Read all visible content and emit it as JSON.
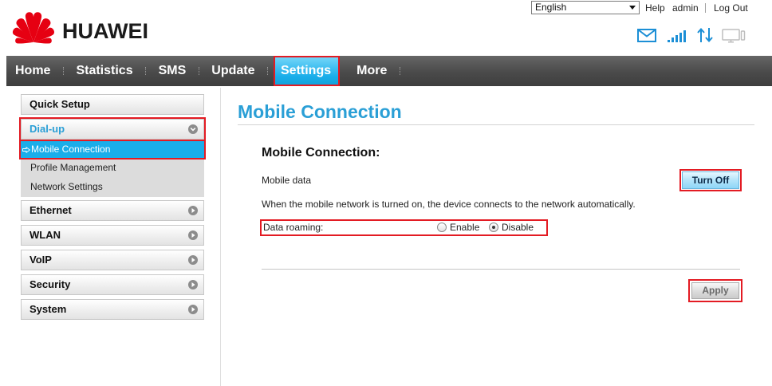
{
  "header": {
    "brand": "HUAWEI",
    "language": "English",
    "help": "Help",
    "user": "admin",
    "logout": "Log Out",
    "status_icons": [
      "mail-icon",
      "signal-icon",
      "data-transfer-icon",
      "monitor-icon"
    ]
  },
  "nav": {
    "items": [
      {
        "label": "Home"
      },
      {
        "label": "Statistics"
      },
      {
        "label": "SMS"
      },
      {
        "label": "Update"
      },
      {
        "label": "Settings",
        "active": true
      },
      {
        "label": "More"
      }
    ]
  },
  "sidebar": {
    "items": [
      {
        "label": "Quick Setup"
      },
      {
        "label": "Dial-up",
        "expanded": true,
        "icon": "chevron-down-icon",
        "children": [
          {
            "label": "Mobile Connection",
            "active": true,
            "icon": "arrow-right-icon"
          },
          {
            "label": "Profile Management"
          },
          {
            "label": "Network Settings"
          }
        ]
      },
      {
        "label": "Ethernet",
        "icon": "chevron-right-icon"
      },
      {
        "label": "WLAN",
        "icon": "chevron-right-icon"
      },
      {
        "label": "VoIP",
        "icon": "chevron-right-icon"
      },
      {
        "label": "Security",
        "icon": "chevron-right-icon"
      },
      {
        "label": "System",
        "icon": "chevron-right-icon"
      }
    ]
  },
  "main": {
    "page_title": "Mobile Connection",
    "section_title": "Mobile Connection:",
    "mobile_data": {
      "label": "Mobile data",
      "button": "Turn Off"
    },
    "description": "When the mobile network is turned on, the device connects to the network automatically.",
    "data_roaming": {
      "label": "Data roaming:",
      "options": [
        {
          "label": "Enable",
          "checked": false
        },
        {
          "label": "Disable",
          "checked": true
        }
      ]
    },
    "apply_button": "Apply"
  },
  "colors": {
    "brand_red": "#e60012",
    "annotation_red": "#e31b23",
    "active_blue": "#1aaeea",
    "title_blue": "#2a9fd6",
    "icon_blue": "#1c8fd6"
  }
}
